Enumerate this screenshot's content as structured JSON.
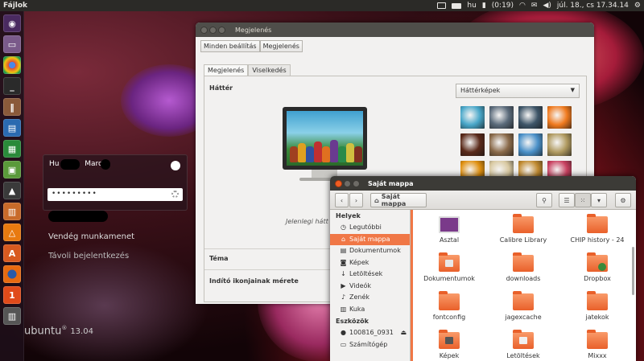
{
  "topbar": {
    "app_title": "Fájlok",
    "keyboard": "hu",
    "battery": "(0:19)",
    "clock": "júl. 18., cs  17.34.14"
  },
  "launcher": {
    "items": [
      "ubuntu-dash-icon",
      "files-icon",
      "chrome-icon",
      "terminal-icon",
      "library-icon",
      "writer-icon",
      "calc-icon",
      "minecraft-icon",
      "inkscape-icon",
      "document-viewer-icon",
      "vlc-icon",
      "software-center-icon",
      "firefox-icon",
      "ubuntu-one-icon",
      "trash-icon"
    ]
  },
  "login": {
    "user_partial_1": "Hu",
    "user_partial_2": "Marc",
    "password_mask": "•••••••••",
    "guest_label": "Vendég munkamenet",
    "remote_label": "Távoli bejelentkezés",
    "ubuntu_text": "ubuntu",
    "ubuntu_sup": "®",
    "ubuntu_version": "13.04"
  },
  "appearance": {
    "title": "Megjelenés",
    "crumb_all": "Minden beállítás",
    "crumb_current": "Megjelenés",
    "tab_appearance": "Megjelenés",
    "tab_behavior": "Viselkedés",
    "background_label": "Háttér",
    "current_bg": "Jelenlegi hátt",
    "wallpaper_combo": "Háttérképek",
    "theme_label": "Téma",
    "icon_size_label": "Indító ikonjainak mérete",
    "thumb_colors": [
      "#49a7c9",
      "#5a6a7a",
      "#3e5568",
      "#f07a1e",
      "#5a2a1a",
      "#8a6a4a",
      "#4a90c8",
      "#b09a60",
      "#e09010",
      "#d8c8a0",
      "#c08a30",
      "#c84060"
    ]
  },
  "files": {
    "title": "Saját mappa",
    "path_button": "Saját mappa",
    "places_header": "Helyek",
    "places": [
      {
        "label": "Legutóbbi",
        "icon": "clock-icon",
        "glyph": "◷"
      },
      {
        "label": "Saját mappa",
        "icon": "home-icon",
        "glyph": "⌂"
      },
      {
        "label": "Dokumentumok",
        "icon": "documents-icon",
        "glyph": "▤"
      },
      {
        "label": "Képek",
        "icon": "camera-icon",
        "glyph": "◙"
      },
      {
        "label": "Letöltések",
        "icon": "download-icon",
        "glyph": "↓"
      },
      {
        "label": "Videók",
        "icon": "video-icon",
        "glyph": "▶"
      },
      {
        "label": "Zenék",
        "icon": "music-icon",
        "glyph": "♪"
      },
      {
        "label": "Kuka",
        "icon": "trash-icon",
        "glyph": "▥"
      }
    ],
    "devices_header": "Eszközök",
    "devices": [
      {
        "label": "100816_0931",
        "icon": "drive-icon",
        "glyph": "●",
        "eject": "⏏"
      },
      {
        "label": "Számítógép",
        "icon": "computer-icon",
        "glyph": "▭"
      }
    ],
    "items": [
      {
        "label": "Asztal",
        "kind": "desktop"
      },
      {
        "label": "Calibre Library",
        "kind": "folder"
      },
      {
        "label": "CHIP history - 24",
        "kind": "folder"
      },
      {
        "label": "Dokumentumok",
        "kind": "doc"
      },
      {
        "label": "downloads",
        "kind": "folder"
      },
      {
        "label": "Dropbox",
        "kind": "dropbox"
      },
      {
        "label": "fontconfig",
        "kind": "folder"
      },
      {
        "label": "jagexcache",
        "kind": "folder"
      },
      {
        "label": "jatekok",
        "kind": "folder"
      },
      {
        "label": "Képek",
        "kind": "pics"
      },
      {
        "label": "Letöltések",
        "kind": "dl"
      },
      {
        "label": "Mixxx",
        "kind": "folder"
      }
    ]
  }
}
